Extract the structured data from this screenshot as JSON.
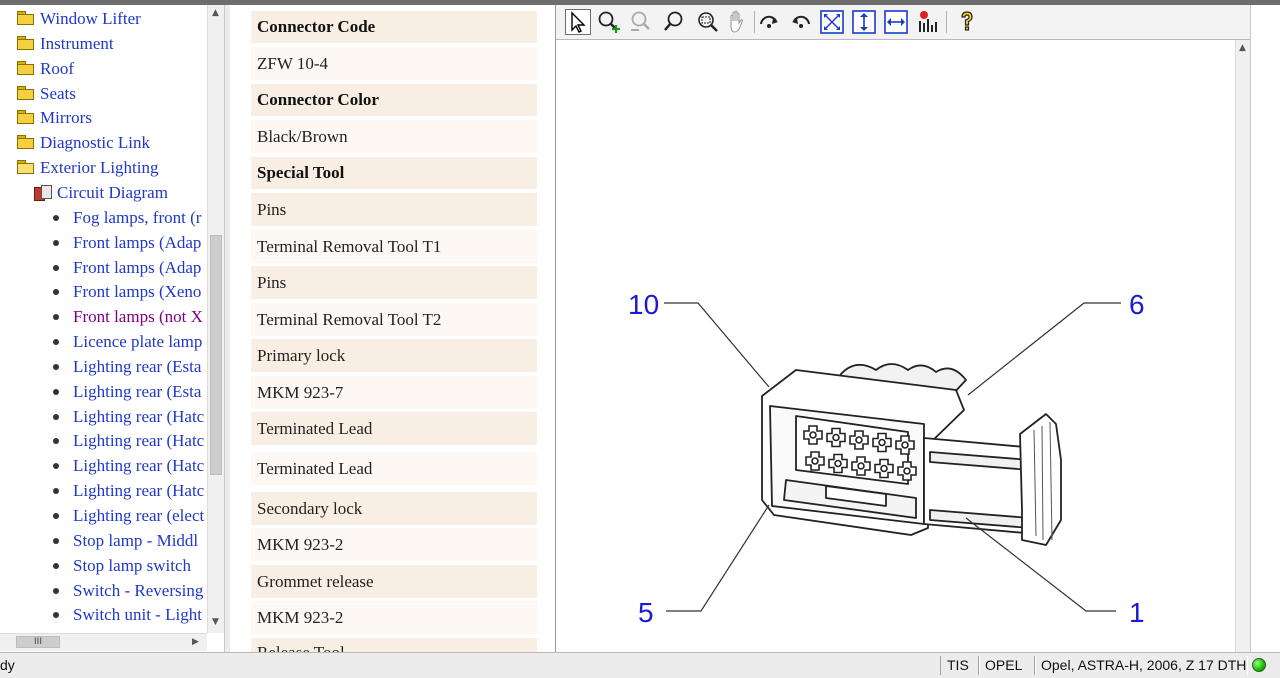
{
  "tree": {
    "items": [
      {
        "label": "Window Lifter",
        "kind": "folder"
      },
      {
        "label": "Instrument",
        "kind": "folder"
      },
      {
        "label": "Roof",
        "kind": "folder"
      },
      {
        "label": "Seats",
        "kind": "folder"
      },
      {
        "label": "Mirrors",
        "kind": "folder"
      },
      {
        "label": "Diagnostic Link",
        "kind": "folder"
      },
      {
        "label": "Exterior Lighting",
        "kind": "open-folder"
      },
      {
        "label": "Circuit Diagram",
        "kind": "book"
      },
      {
        "label": "Fog lamps, front (r",
        "kind": "leaf"
      },
      {
        "label": "Front lamps (Adap",
        "kind": "leaf"
      },
      {
        "label": "Front lamps (Adap",
        "kind": "leaf"
      },
      {
        "label": "Front lamps (Xeno",
        "kind": "leaf"
      },
      {
        "label": "Front lamps (not X",
        "kind": "leaf",
        "visited": true
      },
      {
        "label": "Licence plate lamp",
        "kind": "leaf"
      },
      {
        "label": "Lighting rear (Esta",
        "kind": "leaf"
      },
      {
        "label": "Lighting rear (Esta",
        "kind": "leaf"
      },
      {
        "label": "Lighting rear (Hatc",
        "kind": "leaf"
      },
      {
        "label": "Lighting rear (Hatc",
        "kind": "leaf"
      },
      {
        "label": "Lighting rear (Hatc",
        "kind": "leaf"
      },
      {
        "label": "Lighting rear (Hatc",
        "kind": "leaf"
      },
      {
        "label": "Lighting rear (elect",
        "kind": "leaf"
      },
      {
        "label": "Stop lamp - Middl",
        "kind": "leaf"
      },
      {
        "label": "Stop lamp switch",
        "kind": "leaf"
      },
      {
        "label": "Switch - Reversing",
        "kind": "leaf"
      },
      {
        "label": "Switch unit - Light",
        "kind": "leaf"
      }
    ],
    "hscroll_thumb": "III"
  },
  "info": {
    "rows": [
      {
        "text": "Connector Code",
        "type": "hdr"
      },
      {
        "text": "ZFW 10-4",
        "type": "val"
      },
      {
        "text": "Connector Color",
        "type": "hdr"
      },
      {
        "text": "Black/Brown",
        "type": "val"
      },
      {
        "text": "Special Tool",
        "type": "hdr"
      },
      {
        "text": "Pins",
        "type": "hdr2"
      },
      {
        "text": "Terminal Removal Tool T1",
        "type": "val"
      },
      {
        "text": "Pins",
        "type": "hdr2"
      },
      {
        "text": "Terminal Removal Tool T2",
        "type": "val"
      },
      {
        "text": "Primary lock",
        "type": "hdr2"
      },
      {
        "text": "MKM 923-7",
        "type": "val"
      },
      {
        "text": "Terminated Lead",
        "type": "hdr2"
      },
      {
        "text": "Terminated Lead",
        "type": "val"
      },
      {
        "text": "Secondary lock",
        "type": "hdr2"
      },
      {
        "text": "MKM 923-2",
        "type": "val"
      },
      {
        "text": "Grommet release",
        "type": "hdr2"
      },
      {
        "text": "MKM 923-2",
        "type": "val"
      },
      {
        "text": "Release Tool",
        "type": "hdr2"
      }
    ]
  },
  "toolbar": {
    "buttons": [
      {
        "name": "select-pointer-icon",
        "active": true
      },
      {
        "name": "zoom-in-icon"
      },
      {
        "name": "zoom-out-icon"
      },
      {
        "name": "zoom-icon"
      },
      {
        "name": "zoom-area-icon"
      },
      {
        "name": "pan-hand-icon"
      },
      {
        "name": "rotate-cw-icon"
      },
      {
        "name": "rotate-ccw-icon"
      },
      {
        "name": "fit-page-icon"
      },
      {
        "name": "fit-height-icon"
      },
      {
        "name": "fit-width-icon"
      },
      {
        "name": "grid-icon"
      },
      {
        "name": "help-icon"
      }
    ]
  },
  "diagram": {
    "labels": {
      "pin_top_left": "10",
      "pin_top_right": "6",
      "pin_bottom_left": "5",
      "pin_bottom_right": "1"
    },
    "label_color": "#1a1ad6"
  },
  "status": {
    "ready": "dy",
    "app": "TIS",
    "brand": "OPEL",
    "vehicle": "Opel, ASTRA-H, 2006, Z 17 DTH",
    "led_color": "#19b800"
  }
}
